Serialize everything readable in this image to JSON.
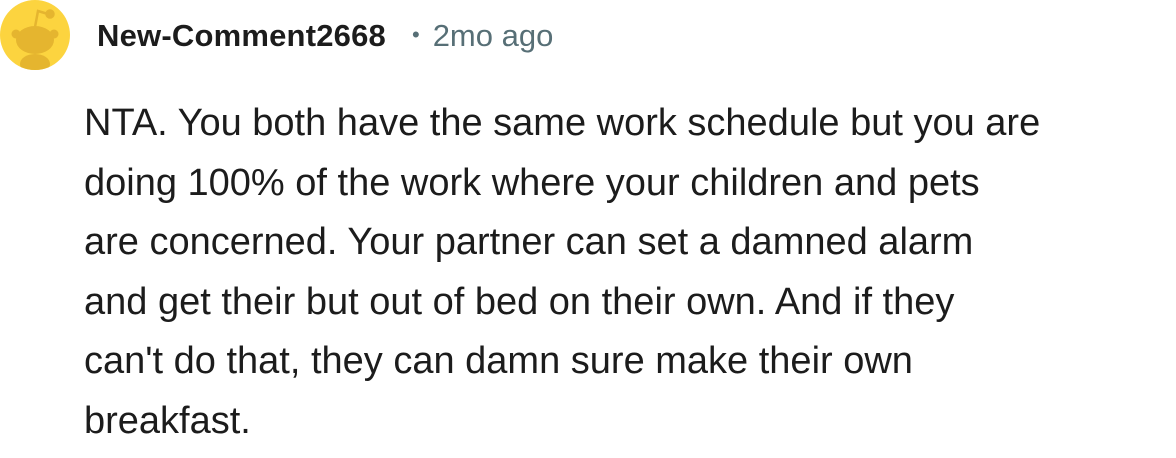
{
  "comment": {
    "author": "New-Comment2668",
    "separator": "•",
    "age": "2mo ago",
    "body_lines": [
      "NTA. You both have the same work schedule but you are",
      "doing 100% of the work where your children and pets",
      "are concerned. Your partner can set a damned alarm",
      "and get their but out of bed on their own. And if they",
      "can't do that, they can damn sure make their own",
      "breakfast."
    ]
  },
  "icons": {
    "avatar": "snoo-avatar-icon"
  },
  "colors": {
    "avatar_background": "#fcd43f",
    "avatar_figure": "#e5b52f",
    "text": "#1c1c1c",
    "meta_text": "#576f76"
  }
}
